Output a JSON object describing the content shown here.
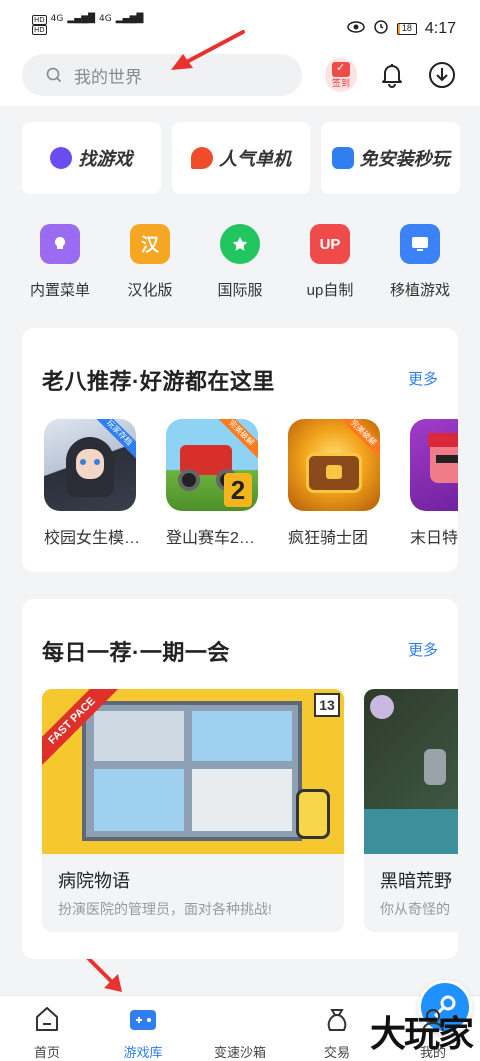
{
  "status_bar": {
    "time": "4:17",
    "battery": "18",
    "network": "4G"
  },
  "search": {
    "placeholder": "我的世界"
  },
  "header": {
    "checkin_label": "签到"
  },
  "quick_links": [
    {
      "label": "找游戏",
      "color": "#6b4cf0"
    },
    {
      "label": "人气单机",
      "color": "#f04b2a"
    },
    {
      "label": "免安装秒玩",
      "color": "#2f7ff0"
    }
  ],
  "categories": [
    {
      "label": "内置菜单",
      "icon": "menu-icon",
      "color": "#9b6cf2"
    },
    {
      "label": "汉化版",
      "icon": "chinese-icon",
      "color": "#f5a623",
      "glyph": "汉"
    },
    {
      "label": "国际服",
      "icon": "globe-icon",
      "color": "#22c55e"
    },
    {
      "label": "up自制",
      "icon": "up-icon",
      "color": "#ef4b4b",
      "glyph": "UP"
    },
    {
      "label": "移植游戏",
      "icon": "port-icon",
      "color": "#3b82f6"
    }
  ],
  "section1": {
    "title": "老八推荐·好游都在这里",
    "more": "更多",
    "games": [
      {
        "name": "校园女生模…",
        "tag": "玩家存档"
      },
      {
        "name": "登山赛车2…",
        "tag": "完美破解"
      },
      {
        "name": "疯狂骑士团",
        "tag": "完美破解"
      },
      {
        "name": "末日特攻",
        "tag": ""
      }
    ]
  },
  "section2": {
    "title": "每日一荐·一期一会",
    "more": "更多",
    "features": [
      {
        "title": "病院物语",
        "desc": "扮演医院的管理员，面对各种挑战!",
        "banner": "FAST PACE",
        "badge": "13"
      },
      {
        "title": "黑暗荒野",
        "desc": "你从奇怪的"
      }
    ]
  },
  "tabbar": {
    "tabs": [
      {
        "label": "首页"
      },
      {
        "label": "游戏库"
      },
      {
        "label": "变速沙箱"
      },
      {
        "label": "交易"
      },
      {
        "label": "我的"
      }
    ]
  },
  "watermark": "大玩家"
}
